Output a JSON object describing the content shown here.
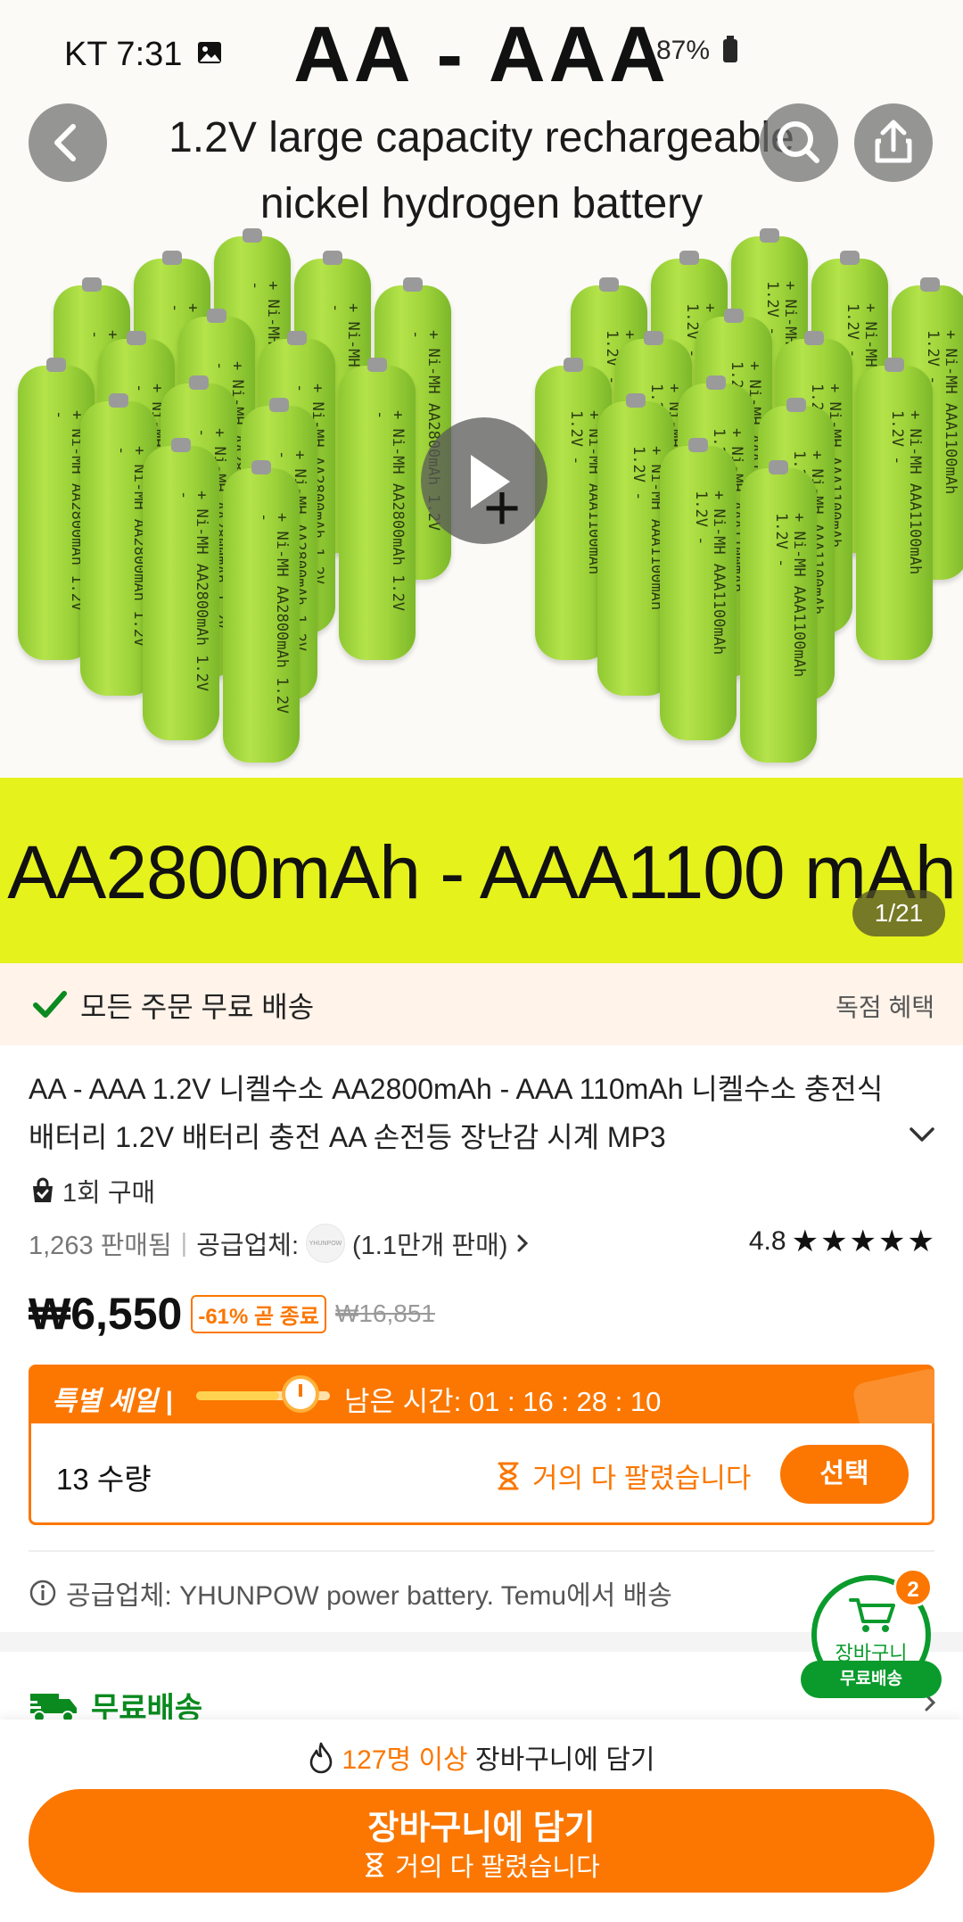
{
  "status_bar": {
    "carrier_time": "KT 7:31",
    "battery": "87%"
  },
  "hero": {
    "headline": "AA - AAA",
    "subtitle_line1": "1.2V large capacity rechargeable",
    "subtitle_line2": "nickel hydrogen battery",
    "battery_label_aa": "+ Ni-MH AA2800mAh 1.2V -",
    "battery_label_aaa": "+ Ni-MH AAA1100mAh 1.2V -",
    "band_text": "AA2800mAh - AAA1100 mAh",
    "image_counter": "1/21"
  },
  "ship_banner": {
    "text": "모든 주문 무료 배송",
    "right": "독점 혜택"
  },
  "product": {
    "title": "AA - AAA 1.2V 니켈수소 AA2800mAh - AAA 110mAh 니켈수소 충전식 배터리 1.2V 배터리 충전 AA 손전등 장난감 시계 MP3",
    "bought": "1회 구매",
    "sold": "1,263 판매됨",
    "supplier_label": "공급업체:",
    "supplier_logo": "YHUNPOW",
    "supplier_sales": "(1.1만개 판매)",
    "rating": "4.8",
    "stars": "★★★★★",
    "price": "₩6,550",
    "discount": "-61% 곧 종료",
    "original_price": "₩16,851"
  },
  "sale": {
    "label": "특별 세일 |",
    "progress": 0.62,
    "countdown": "남은 시간:  01 : 16 : 28 : 10",
    "quantity": "13 수량",
    "almost_sold": "거의 다 팔렸습니다",
    "select": "선택"
  },
  "supplier_info": "공급업체: YHUNPOW power battery. Temu에서 배송",
  "free_shipping": "무료배송",
  "cart": {
    "badge": "2",
    "label": "장바구니",
    "pill": "무료배송"
  },
  "bottom": {
    "people_count": "127명 이상",
    "people_suffix": " 장바구니에 담기",
    "cta": "장바구니에 담기",
    "cta_sub": "거의 다 팔렸습니다"
  },
  "colors": {
    "accent": "#fb7701",
    "green": "#0a9b2c",
    "band": "#e5f21c"
  }
}
